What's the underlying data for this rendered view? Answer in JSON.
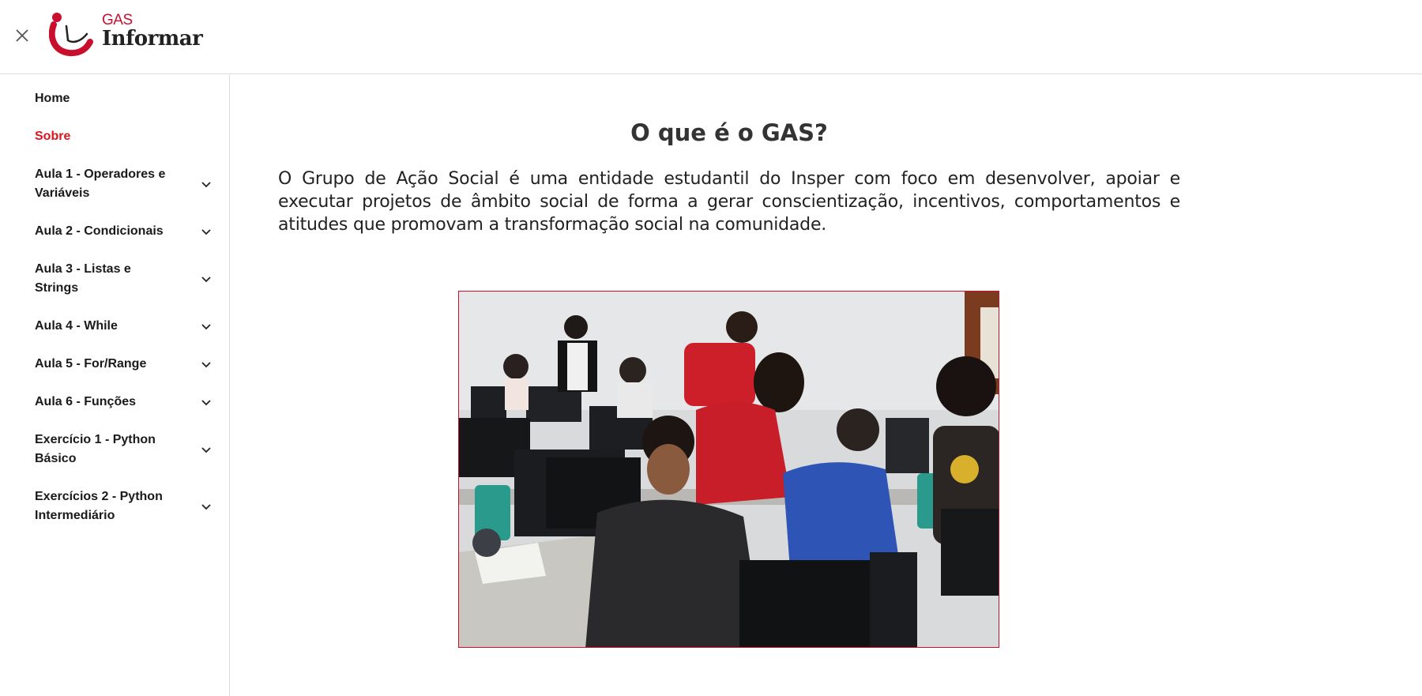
{
  "header": {
    "close_icon": "close-icon",
    "logo": {
      "top": "GAS",
      "name": "Informar"
    }
  },
  "sidebar": {
    "items": [
      {
        "label": "Home",
        "expandable": false,
        "active": false
      },
      {
        "label": "Sobre",
        "expandable": false,
        "active": true
      },
      {
        "label": "Aula 1 - Operadores e Variáveis",
        "expandable": true,
        "active": false
      },
      {
        "label": "Aula 2 - Condicionais",
        "expandable": true,
        "active": false
      },
      {
        "label": "Aula 3 - Listas e Strings",
        "expandable": true,
        "active": false
      },
      {
        "label": "Aula 4 - While",
        "expandable": true,
        "active": false
      },
      {
        "label": "Aula 5 - For/Range",
        "expandable": true,
        "active": false
      },
      {
        "label": "Aula 6 - Funções",
        "expandable": true,
        "active": false
      },
      {
        "label": "Exercício 1 - Python Básico",
        "expandable": true,
        "active": false
      },
      {
        "label": "Exercícios 2 - Python Intermediário",
        "expandable": true,
        "active": false
      }
    ]
  },
  "main": {
    "title": "O que é o GAS?",
    "description": "O Grupo de Ação Social é uma entidade estudantil do Insper com foco em desenvolver, apoiar e executar projetos de âmbito social de forma a gerar conscientização, incentivos, comportamentos e atitudes que promovam a transformação social na comunidade."
  },
  "colors": {
    "accent": "#e0141e",
    "brand": "#c8102e",
    "text": "#222222"
  }
}
